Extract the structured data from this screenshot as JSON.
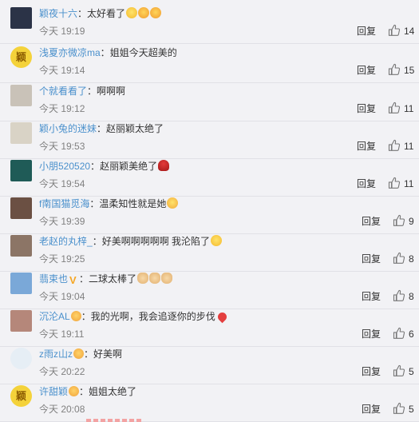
{
  "comments": [
    {
      "user": "颖夜十六",
      "sep": "：",
      "text": "太好看了",
      "emojis": [
        "emo-cry",
        "emo-love",
        "emo-love"
      ],
      "time": "今天 19:19",
      "reply": "回复",
      "likes": "14",
      "avatar_color": "#2b3347",
      "avatar_round": false
    },
    {
      "user": "浅夏亦微凉ma",
      "sep": "：",
      "text": "姐姐今天超美的",
      "emojis": [],
      "time": "今天 19:14",
      "reply": "回复",
      "likes": "15",
      "avatar_color": "#f4d23a",
      "avatar_round": true,
      "avatar_char": "颖"
    },
    {
      "user": "个就看看了",
      "sep": "：",
      "text": "啊啊啊",
      "emojis": [],
      "time": "今天 19:12",
      "reply": "回复",
      "likes": "11",
      "avatar_color": "#c9c2b8",
      "avatar_round": false
    },
    {
      "user": "颖小兔的迷妹",
      "sep": "：",
      "text": "赵丽颖太绝了",
      "emojis": [],
      "time": "今天 19:53",
      "reply": "回复",
      "likes": "11",
      "avatar_color": "#d9d3c6",
      "avatar_round": false
    },
    {
      "user": "小朋520520",
      "sep": "：",
      "text": "赵丽颖美绝了",
      "emojis": [
        "emo-rose"
      ],
      "time": "今天 19:54",
      "reply": "回复",
      "likes": "11",
      "avatar_color": "#1f5b57",
      "avatar_round": false
    },
    {
      "user": "f南国猫觅海",
      "sep": "：",
      "text": "温柔知性就是她",
      "emojis": [
        "emo-shock"
      ],
      "time": "今天 19:39",
      "reply": "回复",
      "likes": "9",
      "avatar_color": "#6b5043",
      "avatar_round": false
    },
    {
      "user": "老赵的丸梓_",
      "sep": "：",
      "text": "好美啊啊啊啊啊 我沦陷了",
      "emojis": [
        "emo-cry"
      ],
      "time": "今天 19:25",
      "reply": "回复",
      "likes": "8",
      "avatar_color": "#8c7566",
      "avatar_round": false
    },
    {
      "user": "翡束也",
      "sep": "：",
      "text": "二球太棒了",
      "emojis": [
        "emo-thumb",
        "emo-thumb",
        "emo-thumb"
      ],
      "time": "今天 19:04",
      "reply": "回复",
      "likes": "8",
      "avatar_color": "#7aa8d8",
      "avatar_round": false,
      "vbadge": "V"
    },
    {
      "user": "沉沦AL",
      "sep": "：",
      "text": "我的光啊，我会追逐你的步伐",
      "emojis": [
        "emo-heart"
      ],
      "time": "今天 19:11",
      "reply": "回复",
      "likes": "6",
      "avatar_color": "#b5877a",
      "avatar_round": false,
      "badge": true
    },
    {
      "user": "z雨z山z",
      "sep": "：",
      "text": "好美啊",
      "emojis": [],
      "time": "今天 20:22",
      "reply": "回复",
      "likes": "5",
      "avatar_color": "#e6eef5",
      "avatar_round": true,
      "badge": true
    },
    {
      "user": "许甜颖",
      "sep": "：",
      "text": "姐姐太绝了",
      "emojis": [],
      "time": "今天 20:08",
      "reply": "回复",
      "likes": "5",
      "avatar_color": "#f4d23a",
      "avatar_round": true,
      "avatar_char": "颖",
      "badge": true
    }
  ],
  "icons": {
    "like": "thumbs-up-icon"
  }
}
